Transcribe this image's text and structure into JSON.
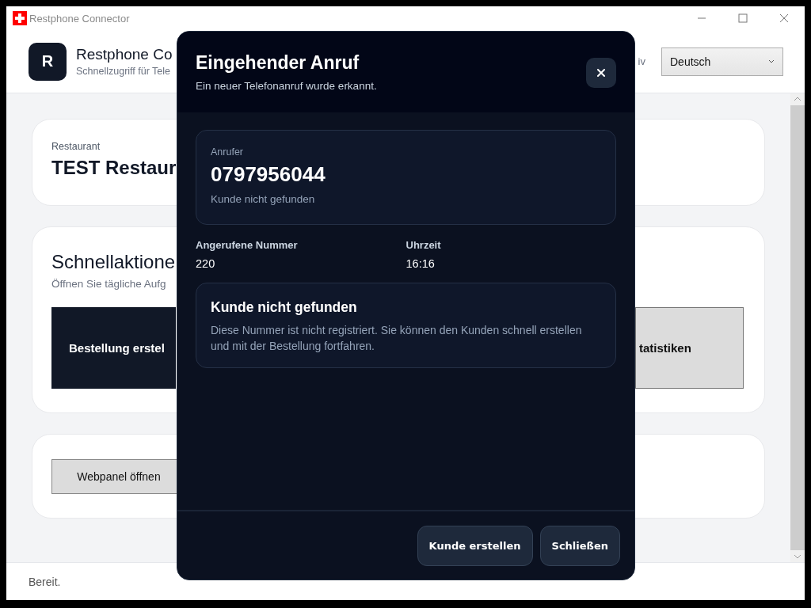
{
  "window": {
    "title": "Restphone Connector"
  },
  "header": {
    "logo_letter": "R",
    "title": "Restphone Co",
    "subtitle": "Schnellzugriff für Tele",
    "partial_text": "iv",
    "language": "Deutsch"
  },
  "restaurant_card": {
    "label": "Restaurant",
    "name": "TEST Restaur"
  },
  "quick_actions": {
    "title": "Schnellaktione",
    "subtitle": "Öffnen Sie tägliche Aufg",
    "buttons": [
      {
        "label": "Bestellung erstel",
        "kind": "primary"
      },
      {
        "label": "tatistiken",
        "kind": "secondary"
      }
    ]
  },
  "links_card": {
    "buttons": [
      "Webpanel öffnen"
    ]
  },
  "status_bar": "Bereit.",
  "dialog": {
    "title": "Eingehender Anruf",
    "subtitle": "Ein neuer Telefonanruf wurde erkannt.",
    "caller": {
      "label": "Anrufer",
      "number": "0797956044",
      "status": "Kunde nicht gefunden"
    },
    "details": [
      {
        "label": "Angerufene Nummer",
        "value": "220"
      },
      {
        "label": "Uhrzeit",
        "value": "16:16"
      }
    ],
    "notice": {
      "title": "Kunde nicht gefunden",
      "text": "Diese Nummer ist nicht registriert. Sie können den Kunden schnell erstellen und mit der Bestellung fortfahren."
    },
    "buttons": [
      "Kunde erstellen",
      "Schließen"
    ]
  }
}
